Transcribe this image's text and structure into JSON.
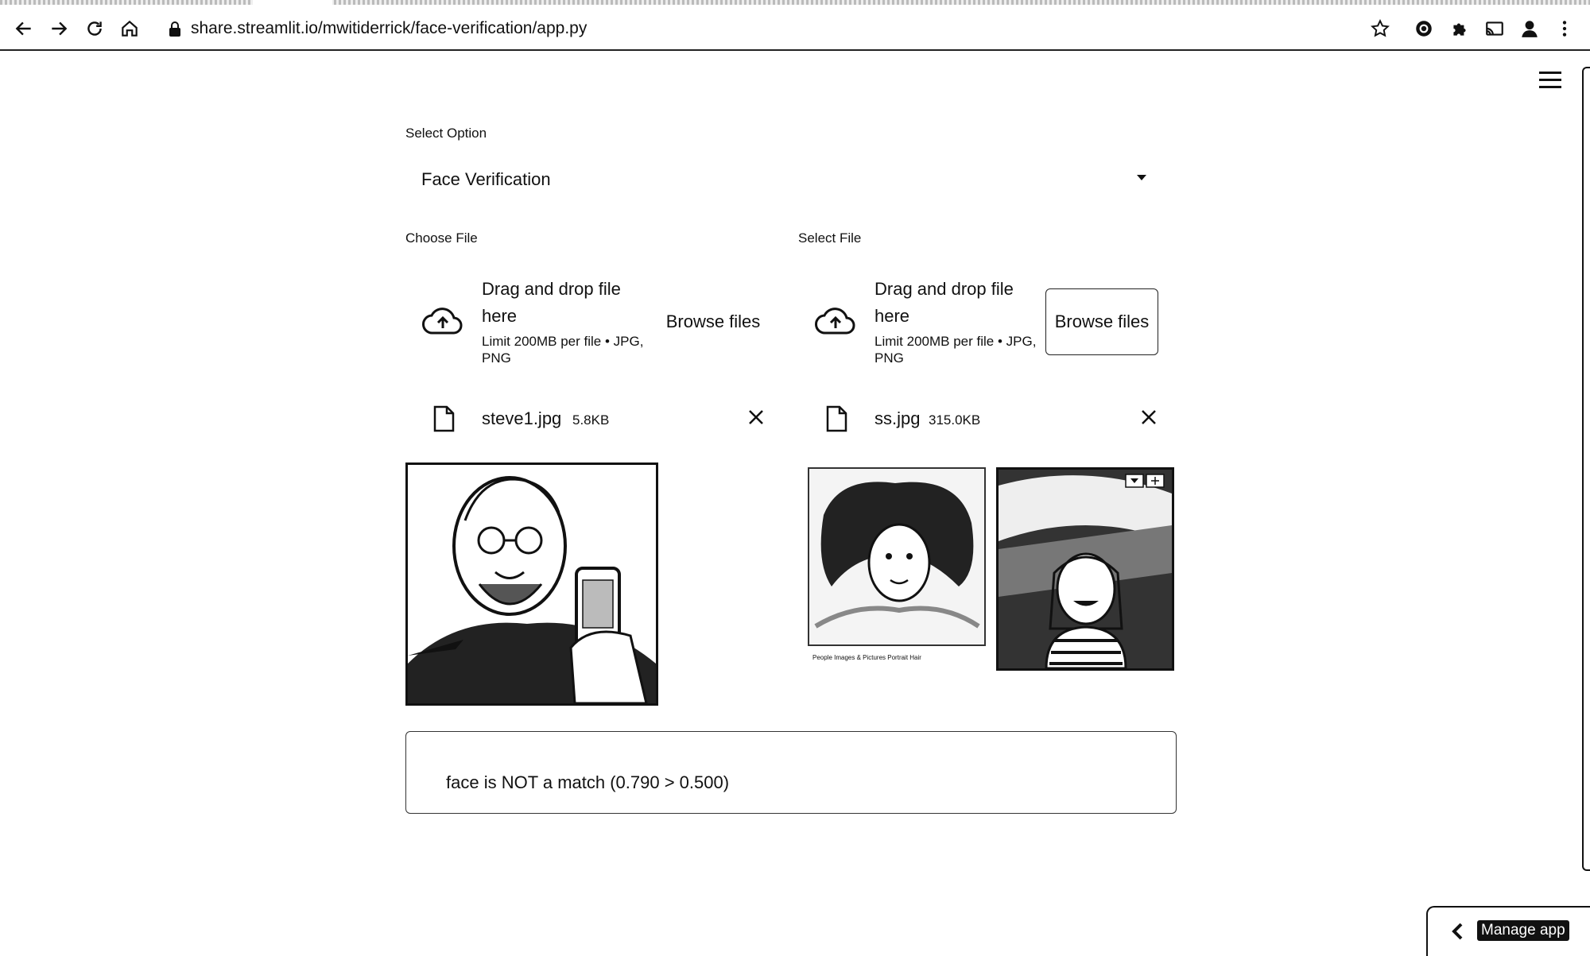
{
  "browser": {
    "url": "share.streamlit.io/mwitiderrick/face-verification/app.py",
    "icons": [
      "back-arrow-icon",
      "forward-arrow-icon",
      "reload-icon",
      "home-icon",
      "lock-icon",
      "star-icon",
      "extension-icon",
      "puzzle-icon",
      "cast-icon",
      "profile-icon",
      "more-vert-icon"
    ]
  },
  "app": {
    "select_option_label": "Select Option",
    "select_option_value": "Face Verification",
    "left_uploader": {
      "label": "Choose File",
      "drop_text": "Drag and drop file here",
      "limit_text": "Limit 200MB per file • JPG, PNG",
      "browse_label": "Browse files",
      "file_name": "steve1.jpg",
      "file_size": "5.8KB"
    },
    "right_uploader": {
      "label": "Select File",
      "drop_text": "Drag and drop file here",
      "limit_text": "Limit 200MB per file • JPG, PNG",
      "browse_label": "Browse files",
      "file_name": "ss.jpg",
      "file_size": "315.0KB"
    },
    "preview_caption": "People Images & Pictures    Portrait    Hair",
    "result_text": "face is NOT a match (0.790 > 0.500)",
    "manage_app_label": "Manage app"
  }
}
